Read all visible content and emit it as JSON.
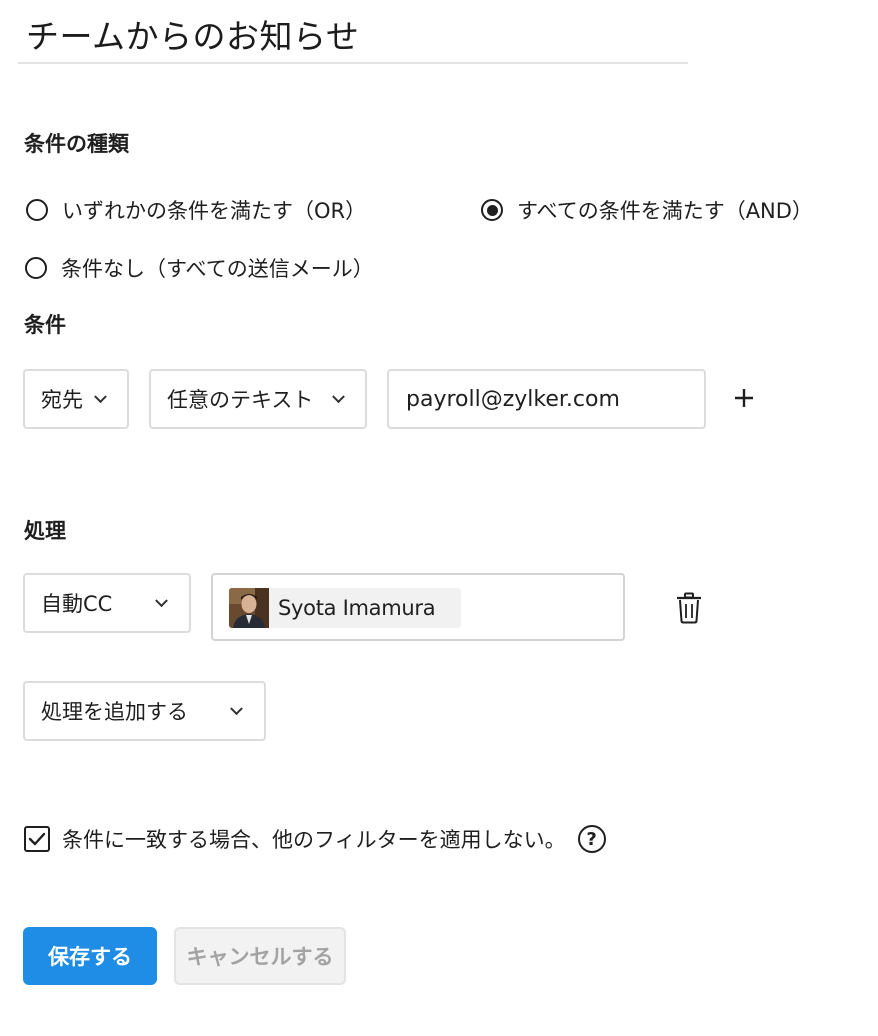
{
  "filter": {
    "name": "チームからのお知らせ"
  },
  "condition_type": {
    "label": "条件の種類",
    "options": [
      {
        "label": "いずれかの条件を満たす（OR）",
        "selected": false
      },
      {
        "label": "すべての条件を満たす（AND）",
        "selected": true
      },
      {
        "label": "条件なし（すべての送信メール）",
        "selected": false
      }
    ]
  },
  "conditions": {
    "label": "条件",
    "rows": [
      {
        "field": "宛先",
        "operator": "任意のテキスト",
        "value": "payroll@zylker.com"
      }
    ]
  },
  "actions": {
    "label": "処理",
    "rows": [
      {
        "type": "自動CC",
        "recipient": "Syota Imamura"
      }
    ],
    "add_action_label": "処理を追加する"
  },
  "stop_processing": {
    "checked": true,
    "label": "条件に一致する場合、他のフィルターを適用しない。",
    "help_glyph": "?"
  },
  "buttons": {
    "save": "保存する",
    "cancel": "キャンセルする"
  },
  "colors": {
    "primary": "#1f8ce6",
    "text": "#1f1f1f",
    "border": "#dcdcdc"
  },
  "icons": [
    "plus-icon",
    "chevron-down-icon",
    "trash-icon",
    "checkmark-icon",
    "help-icon",
    "user-avatar"
  ]
}
